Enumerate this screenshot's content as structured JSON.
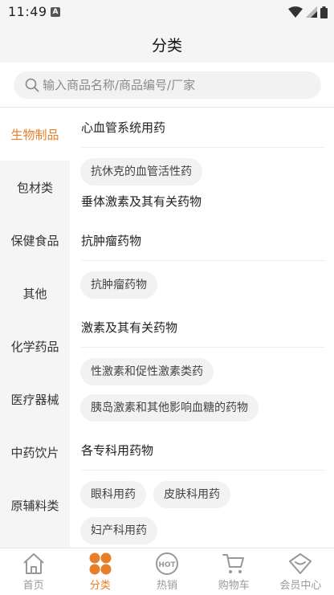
{
  "status_bar": {
    "time": "11:49",
    "badge": "A"
  },
  "header": {
    "title": "分类"
  },
  "search": {
    "placeholder": "输入商品名称/商品编号/厂家"
  },
  "sidebar": {
    "items": [
      {
        "label": "生物制品",
        "active": true
      },
      {
        "label": "包材类"
      },
      {
        "label": "保健食品"
      },
      {
        "label": "其他"
      },
      {
        "label": "化学药品"
      },
      {
        "label": "医疗器械"
      },
      {
        "label": "中药饮片"
      },
      {
        "label": "原辅料类"
      }
    ]
  },
  "categories": [
    {
      "title": "心血管系统用药",
      "chips": [
        "抗休克的血管活性药"
      ]
    },
    {
      "title": "垂体激素及其有关药物",
      "chips": []
    },
    {
      "title": "抗肿瘤药物",
      "chips": [
        "抗肿瘤药物"
      ]
    },
    {
      "title": "激素及其有关药物",
      "chips": [
        "性激素和促性激素类药",
        "胰岛激素和其他影响血糖的药物"
      ]
    },
    {
      "title": "各专科用药物",
      "chips": [
        "眼科用药",
        "皮肤科用药",
        "妇产科用药"
      ]
    }
  ],
  "bottom_nav": {
    "items": [
      {
        "label": "首页",
        "icon": "home-icon"
      },
      {
        "label": "分类",
        "icon": "category-icon",
        "active": true
      },
      {
        "label": "热销",
        "icon": "hot-icon",
        "badge": "HOT"
      },
      {
        "label": "购物车",
        "icon": "cart-icon"
      },
      {
        "label": "会员中心",
        "icon": "member-icon"
      }
    ]
  },
  "colors": {
    "accent": "#e87e28",
    "background": "#f5f5f5",
    "chip": "#f2f2f2",
    "muted": "#999999"
  }
}
